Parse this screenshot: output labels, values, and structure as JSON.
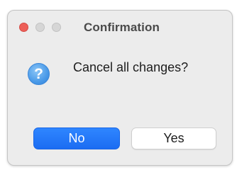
{
  "window": {
    "title": "Confirmation"
  },
  "dialog": {
    "icon": "question-icon",
    "icon_glyph": "?",
    "message": "Cancel all changes?"
  },
  "buttons": {
    "no_label": "No",
    "yes_label": "Yes"
  },
  "colors": {
    "accent": "#1b6cf2",
    "close_button": "#ed5f58",
    "window_background": "#ececec"
  }
}
